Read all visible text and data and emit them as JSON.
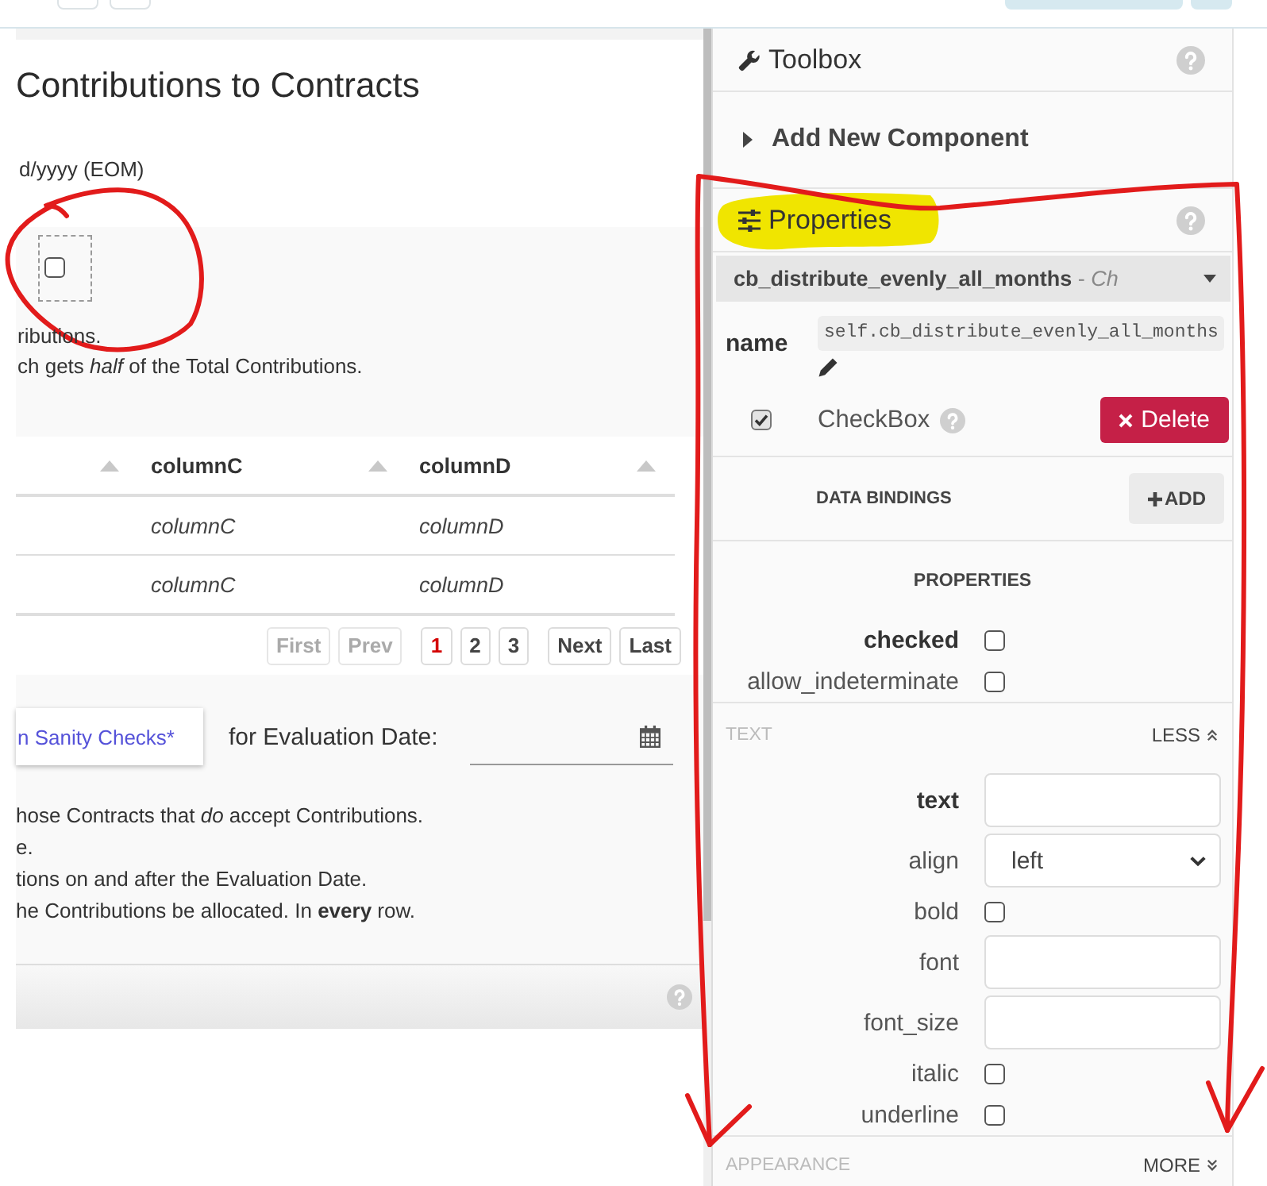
{
  "canvas": {
    "title": "Contributions to Contracts",
    "date_format": "d/yyyy (EOM)",
    "checkbox_component": {
      "checked": false
    },
    "notes": [
      "ributions.",
      "ch gets *half* of the Total Contributions."
    ],
    "table": {
      "columns": [
        {
          "kind": "cut_off"
        },
        {
          "kind": "named",
          "label": "columnC"
        },
        {
          "kind": "named",
          "label": "columnD"
        }
      ],
      "rows": [
        [
          "",
          "columnC",
          "columnD"
        ],
        [
          "",
          "columnC",
          "columnD"
        ]
      ]
    },
    "pagination": [
      {
        "kind": "nav",
        "label": "First",
        "disabled": true
      },
      {
        "kind": "nav",
        "label": "Prev",
        "disabled": true
      },
      {
        "kind": "page",
        "label": "1",
        "selected": true
      },
      {
        "kind": "page",
        "label": "2",
        "selected": false
      },
      {
        "kind": "page",
        "label": "3",
        "selected": false
      },
      {
        "kind": "nav",
        "label": "Next",
        "disabled": false
      },
      {
        "kind": "nav",
        "label": "Last",
        "disabled": false
      }
    ],
    "sanity_button": "n Sanity Checks*",
    "evaluation_label": "for Evaluation Date:",
    "instructions": [
      "hose Contracts that *do* accept Contributions.",
      "e.",
      "tions on and after the Evaluation Date.",
      "he Contributions be allocated. In **every** row."
    ]
  },
  "toolbox": {
    "title": "Toolbox"
  },
  "add_component": {
    "label": "Add New Component",
    "expanded": false
  },
  "properties": {
    "title": "Properties",
    "component": "**cb_distribute_evenly_all_months** - *Ch*",
    "name_label": "name",
    "name_value": "self.cb_distribute_evenly_all_months",
    "component_checkbox": {
      "checked": true
    },
    "type_label": "CheckBox",
    "delete_button": "Delete",
    "data_bindings": {
      "label": "DATA BINDINGS",
      "add_button": "ADD"
    },
    "section_title": "PROPERTIES",
    "props": [
      {
        "label": "checked",
        "primary": true,
        "kind": "checkbox",
        "checked": false
      },
      {
        "label": "allow_indeterminate",
        "primary": false,
        "kind": "checkbox",
        "checked": false
      }
    ],
    "groups": [
      {
        "title": "TEXT",
        "toggle": "LESS",
        "expanded": true,
        "props": [
          {
            "label": "text",
            "primary": true,
            "kind": "input"
          },
          {
            "label": "align",
            "primary": false,
            "kind": "select",
            "value": "left"
          },
          {
            "label": "bold",
            "primary": false,
            "kind": "checkbox",
            "checked": false
          },
          {
            "label": "font",
            "primary": false,
            "kind": "input"
          },
          {
            "label": "font_size",
            "primary": false,
            "kind": "input"
          },
          {
            "label": "italic",
            "primary": false,
            "kind": "checkbox",
            "checked": false
          },
          {
            "label": "underline",
            "primary": false,
            "kind": "checkbox",
            "checked": false
          }
        ]
      },
      {
        "title": "APPEARANCE",
        "toggle": "MORE",
        "expanded": false
      }
    ]
  },
  "annotations": [
    {
      "kind": "highlight"
    },
    {
      "kind": "circle"
    },
    {
      "kind": "outline_arrows"
    }
  ]
}
